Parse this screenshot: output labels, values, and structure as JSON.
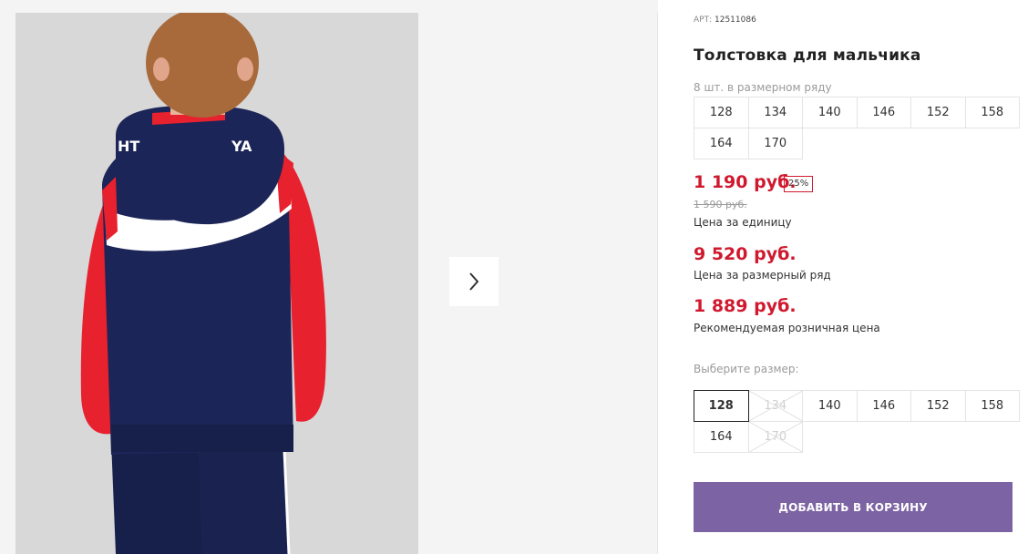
{
  "gallery": {
    "hood_print_left": "HT",
    "hood_print_right": "YA",
    "next_icon": "chevron-right-icon"
  },
  "product": {
    "sku_label": "АРТ:",
    "sku_value": "12511086",
    "title": "Толстовка для мальчика",
    "pack_note": "8 шт. в размерном ряду",
    "pack_sizes": [
      "128",
      "134",
      "140",
      "146",
      "152",
      "158",
      "164",
      "170"
    ]
  },
  "prices": {
    "unit_price": "1 190 руб.",
    "discount": "25%",
    "old_price": "1 590 руб.",
    "unit_note": "Цена за единицу",
    "pack_price": "9 520 руб.",
    "pack_note": "Цена за размерный ряд",
    "retail_price": "1 889 руб.",
    "retail_note": "Рекомендуемая розничная цена"
  },
  "size_picker": {
    "label": "Выберите размер:",
    "sizes": [
      {
        "value": "128",
        "state": "selected"
      },
      {
        "value": "134",
        "state": "unavailable"
      },
      {
        "value": "140",
        "state": "available"
      },
      {
        "value": "146",
        "state": "available"
      },
      {
        "value": "152",
        "state": "available"
      },
      {
        "value": "158",
        "state": "available"
      },
      {
        "value": "164",
        "state": "available"
      },
      {
        "value": "170",
        "state": "unavailable"
      }
    ]
  },
  "cart": {
    "button_label": "ДОБАВИТЬ В КОРЗИНУ"
  },
  "colors": {
    "price_red": "#d0192e",
    "button_purple": "#7c63a3",
    "hoodie_navy": "#1c2557",
    "sleeve_red": "#e8212e"
  }
}
